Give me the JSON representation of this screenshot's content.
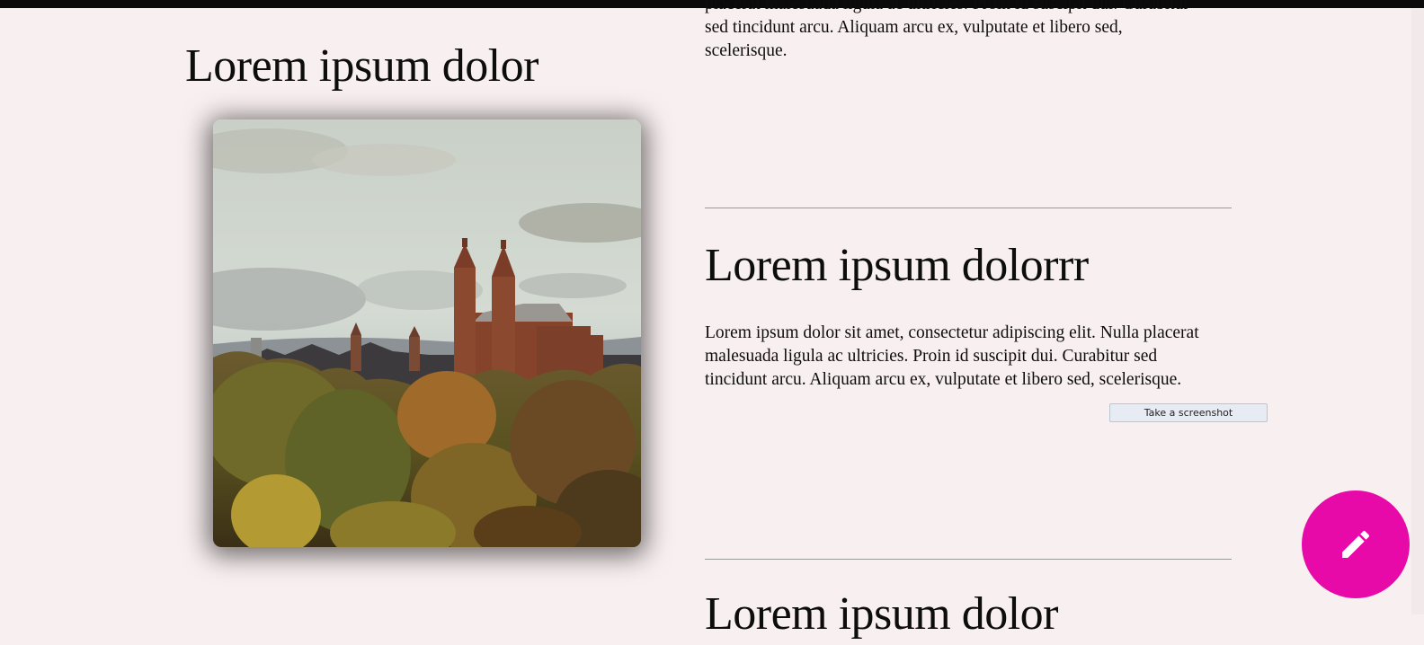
{
  "colors": {
    "background": "#f8eff0",
    "fab": "#e80aa8",
    "divider": "#999999"
  },
  "left": {
    "title": "Lorem ipsum dolor",
    "image_alt": "Autumn trees with a red sandstone gothic building with twin spires under a cloudy sky"
  },
  "sections": {
    "top_paragraph": "placerat malesuada ligula ac ultricies. Proin id suscipit dui. Curabitur sed tincidunt arcu. Aliquam arcu ex, vulputate et libero sed, scelerisque.",
    "middle_title": "Lorem ipsum dolorrr",
    "middle_paragraph": "Lorem ipsum dolor sit amet, consectetur adipiscing elit. Nulla placerat malesuada ligula ac ultricies. Proin id suscipit dui. Curabitur sed tincidunt arcu. Aliquam arcu ex, vulputate et libero sed, scelerisque.",
    "bottom_title": "Lorem ipsum dolor"
  },
  "screenshot_button": {
    "label": "Take a screenshot"
  },
  "fab": {
    "icon": "pencil-icon"
  }
}
